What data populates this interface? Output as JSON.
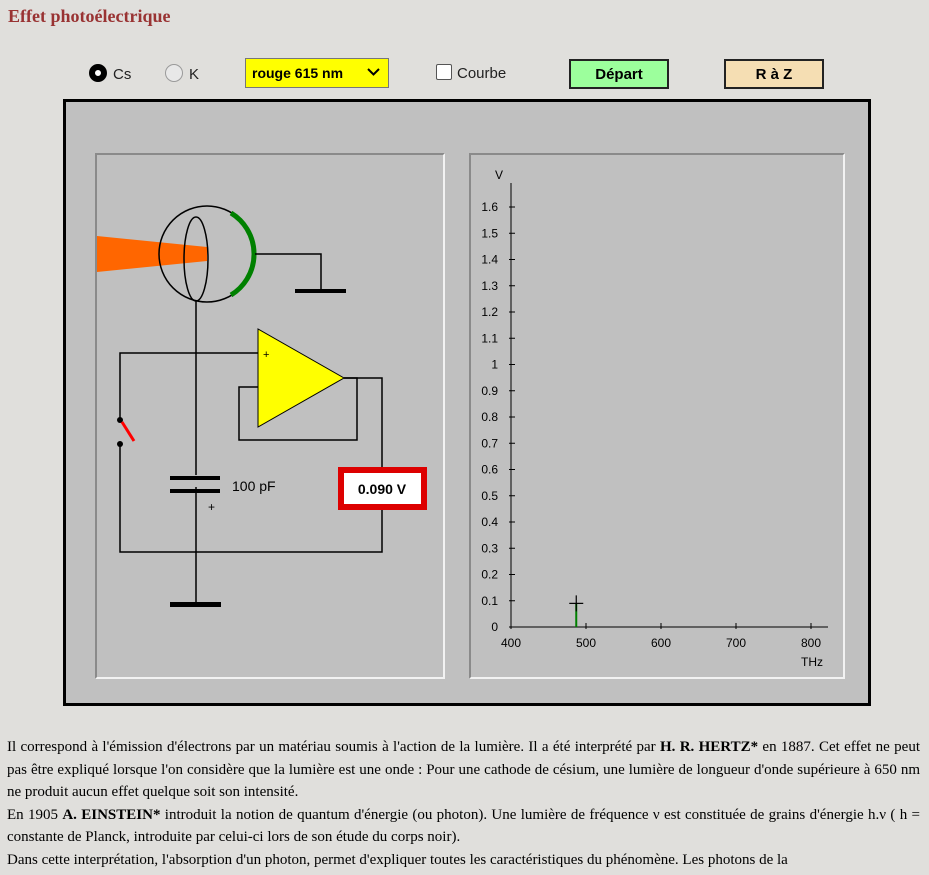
{
  "title": "Effet photoélectrique",
  "controls": {
    "radio_cs": "Cs",
    "radio_k": "K",
    "wavelength_select": "rouge 615 nm",
    "curve_checkbox": "Courbe",
    "start_button": "Départ",
    "reset_button": "R à Z"
  },
  "circuit": {
    "capacitor_label": "100 pF",
    "plus_sign": "+",
    "voltmeter_value": "0.090 V",
    "colors": {
      "light_beam": "#ff6600",
      "cathode": "#008000",
      "amplifier": "#ffff00",
      "meter_border": "#dd0000",
      "switch": "#ff0000"
    }
  },
  "chart_data": {
    "type": "scatter",
    "xlabel": "THz",
    "ylabel": "V",
    "xlim": [
      400,
      800
    ],
    "ylim": [
      0,
      1.6
    ],
    "x_ticks": [
      "400",
      "500",
      "600",
      "700",
      "800"
    ],
    "y_ticks": [
      "0",
      "0.1",
      "0.2",
      "0.3",
      "0.4",
      "0.5",
      "0.6",
      "0.7",
      "0.8",
      "0.9",
      "1",
      "1.1",
      "1.2",
      "1.3",
      "1.4",
      "1.5",
      "1.6"
    ],
    "points": [
      {
        "x": 487,
        "y": 0.09
      }
    ]
  },
  "description": {
    "p1_a": "Il correspond à l'émission d'électrons par un matériau soumis à l'action de la lumière. Il a été interprété par ",
    "p1_b": "H. R. HERTZ*",
    "p1_c": " en 1887. Cet effet ne peut pas être expliqué lorsque l'on considère que la lumière est une onde : Pour une cathode de césium, une lumière de longueur d'onde supérieure à 650 nm ne produit aucun effet quelque soit son intensité.",
    "p2_a": "En 1905 ",
    "p2_b": "A. EINSTEIN*",
    "p2_c": " introduit la notion de quantum d'énergie (ou photon). Une lumière de fréquence ν est constituée de grains d'énergie h.ν ( h = constante de Planck, introduite par celui-ci lors de son étude du corps noir).",
    "p3": "Dans cette interprétation, l'absorption d'un photon, permet d'expliquer toutes les caractéristiques du phénomène. Les photons de la"
  }
}
